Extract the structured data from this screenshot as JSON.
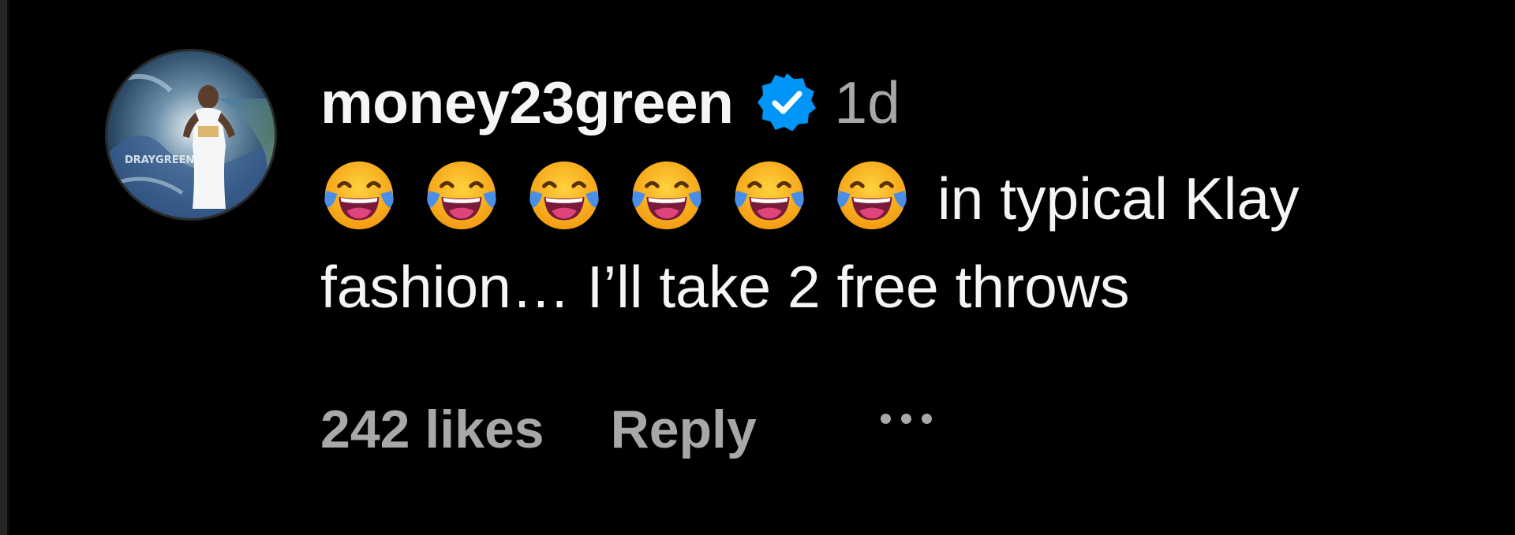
{
  "comment": {
    "username": "money23green",
    "verified": true,
    "timestamp": "1d",
    "emojis": [
      "face-with-tears-of-joy",
      "face-with-tears-of-joy",
      "face-with-tears-of-joy",
      "face-with-tears-of-joy",
      "face-with-tears-of-joy",
      "face-with-tears-of-joy"
    ],
    "text_line1": "in typical Klay",
    "text_line2": "fashion… I’ll take 2 free throws",
    "likes_label": "242 likes",
    "reply_label": "Reply",
    "more_icon": "more-options-icon"
  },
  "colors": {
    "background": "#000000",
    "primary_text": "#f5f5f5",
    "secondary_text": "#a8a8a8",
    "verified_badge": "#0095f6"
  }
}
